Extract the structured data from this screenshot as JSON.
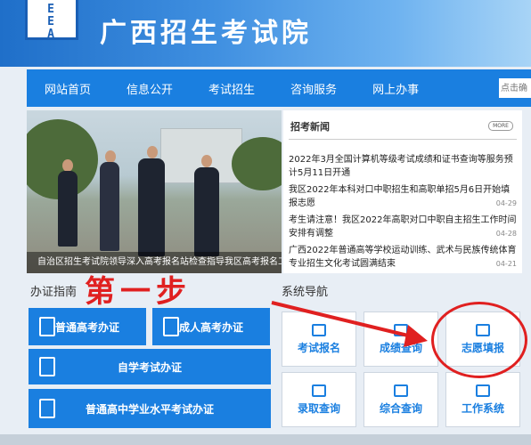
{
  "header": {
    "logo_text": [
      "G",
      "E",
      "E",
      "A"
    ],
    "site_title": "广西招生考试院"
  },
  "nav": {
    "items": [
      "网站首页",
      "信息公开",
      "考试招生",
      "咨询服务",
      "网上办事"
    ],
    "search_placeholder": "点击确"
  },
  "photo": {
    "caption": "自治区招生考试院领导深入高考报名站检查指导我区高考报名工作"
  },
  "news": {
    "title": "招考新闻",
    "more_label": "MORE",
    "items": [
      {
        "text": "2022年3月全国计算机等级考试成绩和证书查询等服务预计5月11日开通",
        "date": ""
      },
      {
        "text": "我区2022年本科对口中职招生和高职单招5月6日开始填报志愿",
        "date": "04-29"
      },
      {
        "text": "考生请注意！我区2022年高职对口中职自主招生工作时间安排有调整",
        "date": "04-28"
      },
      {
        "text": "广西2022年普通高等学校运动训练、武术与民族传统体育专业招生文化考试圆满结束",
        "date": "04-21"
      }
    ]
  },
  "guide": {
    "label": "办证指南",
    "buttons": [
      "普通高考办证",
      "成人高考办证",
      "自学考试办证",
      "普通高中学业水平考试办证"
    ]
  },
  "system": {
    "label": "系统导航",
    "tiles": [
      "考试报名",
      "成绩查询",
      "志愿填报",
      "录取查询",
      "综合查询",
      "工作系统"
    ]
  },
  "annotation": {
    "step_text": "第一步"
  },
  "colors": {
    "accent": "#1a7fe0",
    "annotation": "#e02020"
  }
}
